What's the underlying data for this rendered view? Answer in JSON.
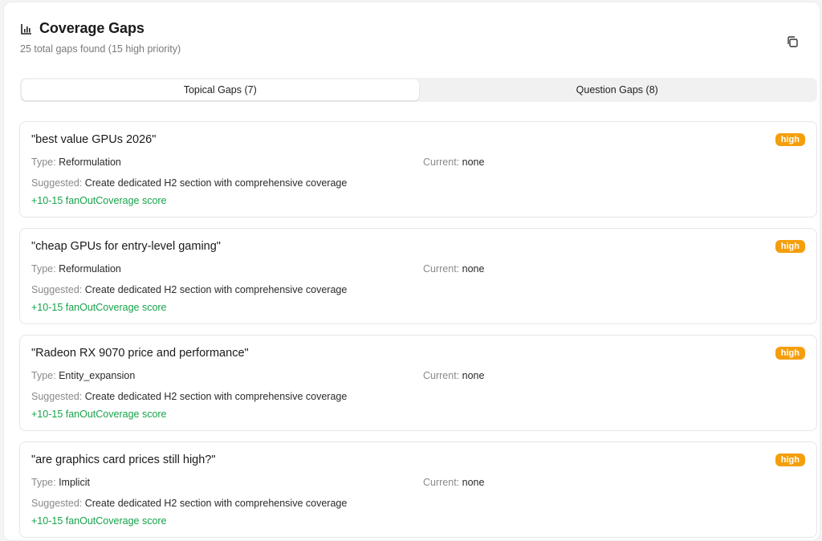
{
  "header": {
    "title": "Coverage Gaps",
    "subtitle": "25 total gaps found (15 high priority)"
  },
  "tabs": [
    {
      "label": "Topical Gaps (7)",
      "active": true
    },
    {
      "label": "Question Gaps (8)",
      "active": false
    }
  ],
  "labels": {
    "type": "Type:",
    "current": "Current:",
    "suggested": "Suggested:"
  },
  "gaps": [
    {
      "query": "\"best value GPUs 2026\"",
      "priority": "high",
      "type": "Reformulation",
      "current": "none",
      "suggested": "Create dedicated H2 section with comprehensive coverage",
      "score": "+10-15 fanOutCoverage score"
    },
    {
      "query": "\"cheap GPUs for entry-level gaming\"",
      "priority": "high",
      "type": "Reformulation",
      "current": "none",
      "suggested": "Create dedicated H2 section with comprehensive coverage",
      "score": "+10-15 fanOutCoverage score"
    },
    {
      "query": "\"Radeon RX 9070 price and performance\"",
      "priority": "high",
      "type": "Entity_expansion",
      "current": "none",
      "suggested": "Create dedicated H2 section with comprehensive coverage",
      "score": "+10-15 fanOutCoverage score"
    },
    {
      "query": "\"are graphics card prices still high?\"",
      "priority": "high",
      "type": "Implicit",
      "current": "none",
      "suggested": "Create dedicated H2 section with comprehensive coverage",
      "score": "+10-15 fanOutCoverage score"
    }
  ],
  "icons": {
    "title_icon": "bar-chart-icon",
    "copy_icon": "copy-icon"
  },
  "colors": {
    "badge_high": "#f59e0b",
    "score_green": "#16a34a"
  }
}
